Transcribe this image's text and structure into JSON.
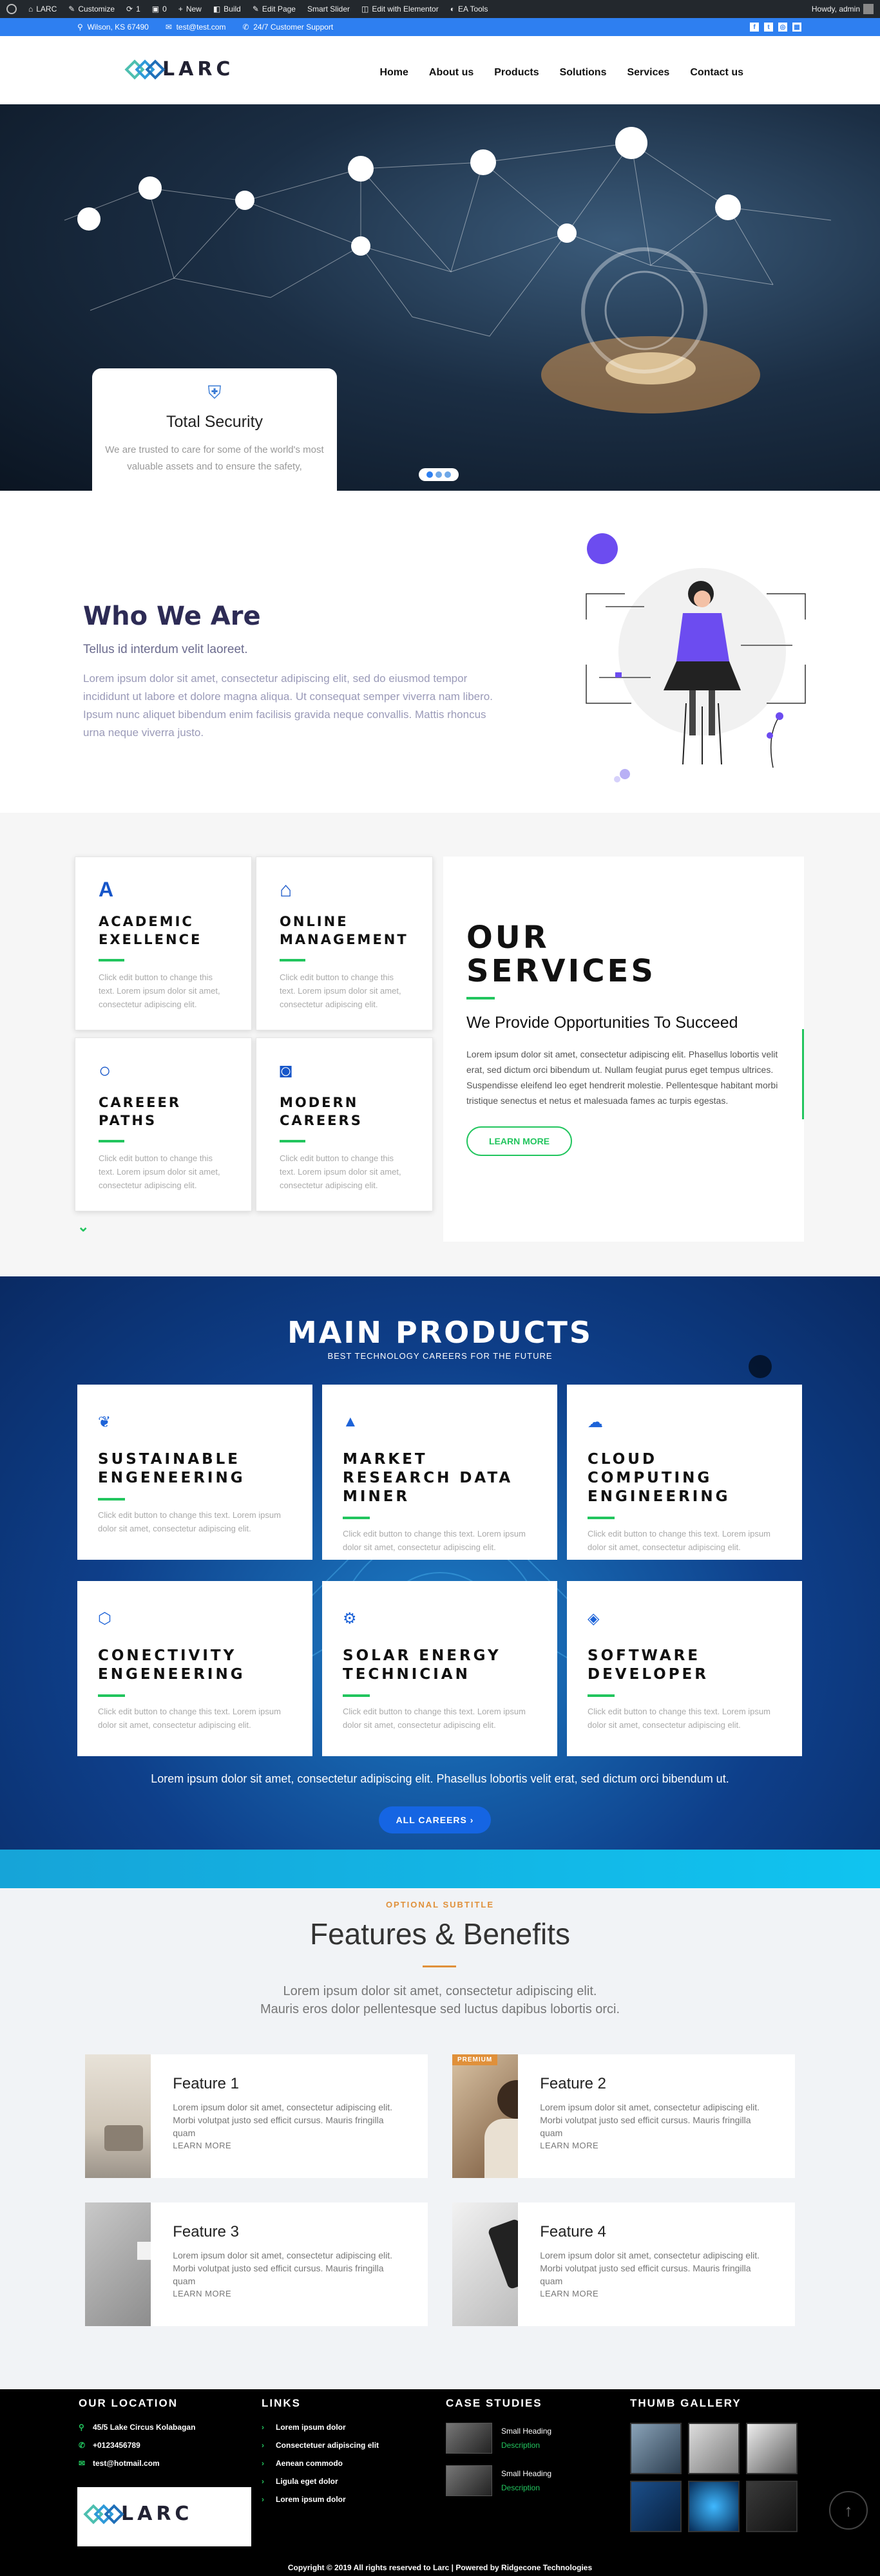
{
  "admin_bar": {
    "site": "LARC",
    "customize": "Customize",
    "updates": "1",
    "comments": "0",
    "new": "New",
    "build": "Build",
    "edit_page": "Edit Page",
    "smart_slider": "Smart Slider",
    "elementor": "Edit with Elementor",
    "ea_tools": "EA Tools",
    "howdy": "Howdy, admin"
  },
  "topbar": {
    "location": "Wilson, KS 67490",
    "email": "test@test.com",
    "phone": "24/7 Customer Support",
    "social": [
      "f",
      "t",
      "◎",
      "▦"
    ]
  },
  "brand": {
    "name": "LARC"
  },
  "nav": [
    "Home",
    "About us",
    "Products",
    "Solutions",
    "Services",
    "Contact us"
  ],
  "hero": {
    "card_title": "Total Security",
    "card_text": "We are trusted to care for some of the world's most valuable assets and to ensure the safety,"
  },
  "who": {
    "title": "Who We Are",
    "subtitle": "Tellus id interdum velit laoreet.",
    "body": "Lorem ipsum dolor sit amet, consectetur adipiscing elit, sed do eiusmod tempor incididunt ut labore et dolore magna aliqua. Ut consequat semper viverra nam libero. Ipsum nunc aliquet bibendum enim facilisis gravida neque convallis. Mattis rhoncus urna neque viverra justo."
  },
  "services": {
    "cards": [
      {
        "icon": "A",
        "title": "ACADEMIC EXELLENCE",
        "text": "Click edit button to change this text. Lorem ipsum dolor sit amet, consectetur adipiscing elit."
      },
      {
        "icon": "⌂",
        "title": "ONLINE MANAGEMENT",
        "text": "Click edit button to change this text. Lorem ipsum dolor sit amet, consectetur adipiscing elit."
      },
      {
        "icon": "○",
        "title": "CAREEER PATHS",
        "text": "Click edit button to change this text. Lorem ipsum dolor sit amet, consectetur adipiscing elit."
      },
      {
        "icon": "◙",
        "title": "MODERN CAREERS",
        "text": "Click edit button to change this text. Lorem ipsum dolor sit amet, consectetur adipiscing elit."
      }
    ],
    "heading": "OUR SERVICES",
    "subheading": "We Provide Opportunities To Succeed",
    "text": "Lorem ipsum dolor sit amet, consectetur adipiscing elit. Phasellus lobortis velit erat, sed dictum orci bibendum ut. Nullam feugiat purus eget tempus ultrices. Suspendisse eleifend leo eget hendrerit molestie. Pellentesque habitant morbi tristique senectus et netus et malesuada fames ac turpis egestas.",
    "button": "LEARN MORE"
  },
  "products": {
    "title": "MAIN PRODUCTS",
    "subtitle": "BEST TECHNOLOGY CAREERS FOR THE FUTURE",
    "cards": [
      {
        "icon": "❦",
        "title": "SUSTAINABLE ENGENEERING",
        "text": "Click edit button to change this text. Lorem ipsum dolor sit amet, consectetur adipiscing elit."
      },
      {
        "icon": "▲",
        "title": "MARKET RESEARCH DATA MINER",
        "text": "Click edit button to change this text. Lorem ipsum dolor sit amet, consectetur adipiscing elit."
      },
      {
        "icon": "☁",
        "title": "CLOUD COMPUTING ENGINEERING",
        "text": "Click edit button to change this text. Lorem ipsum dolor sit amet, consectetur adipiscing elit."
      },
      {
        "icon": "⬡",
        "title": "CONECTIVITY ENGENEERING",
        "text": "Click edit button to change this text. Lorem ipsum dolor sit amet, consectetur adipiscing elit."
      },
      {
        "icon": "⚙",
        "title": "SOLAR ENERGY TECHNICIAN",
        "text": "Click edit button to change this text. Lorem ipsum dolor sit amet, consectetur adipiscing elit."
      },
      {
        "icon": "◈",
        "title": "SOFTWARE DEVELOPER",
        "text": "Click edit button to change this text. Lorem ipsum dolor sit amet, consectetur adipiscing elit."
      }
    ],
    "lead": "Lorem ipsum dolor sit amet, consectetur adipiscing elit. Phasellus lobortis velit erat, sed dictum orci bibendum ut.",
    "button": "ALL CAREERS ›"
  },
  "features": {
    "optional": "OPTIONAL SUBTITLE",
    "title": "Features & Benefits",
    "intro1": "Lorem ipsum dolor sit amet, consectetur adipiscing elit.",
    "intro2": "Mauris eros dolor pellentesque sed luctus dapibus lobortis orci.",
    "items": [
      {
        "title": "Feature 1",
        "text": "Lorem ipsum dolor sit amet, consectetur adipiscing elit. Morbi volutpat justo sed efficit cursus. Mauris fringilla quam",
        "more": "LEARN MORE",
        "badge": ""
      },
      {
        "title": "Feature 2",
        "text": "Lorem ipsum dolor sit amet, consectetur adipiscing elit. Morbi volutpat justo sed efficit cursus. Mauris fringilla quam",
        "more": "LEARN MORE",
        "badge": "PREMIUM"
      },
      {
        "title": "Feature 3",
        "text": "Lorem ipsum dolor sit amet, consectetur adipiscing elit. Morbi volutpat justo sed efficit cursus. Mauris fringilla quam",
        "more": "LEARN MORE",
        "badge": ""
      },
      {
        "title": "Feature 4",
        "text": "Lorem ipsum dolor sit amet, consectetur adipiscing elit. Morbi volutpat justo sed efficit cursus. Mauris fringilla quam",
        "more": "LEARN MORE",
        "badge": ""
      }
    ]
  },
  "footer": {
    "location": {
      "title": "OUR LOCATION",
      "address": "45/5 Lake Circus Kolabagan",
      "phone": "+0123456789",
      "email": "test@hotmail.com"
    },
    "links": {
      "title": "LINKS",
      "items": [
        "Lorem ipsum dolor",
        "Consectetuer adipiscing elit",
        "Aenean commodo",
        "Ligula eget dolor",
        "Lorem ipsum dolor"
      ]
    },
    "case": {
      "title": "CASE STUDIES",
      "items": [
        {
          "heading": "Small Heading",
          "desc": "Description"
        },
        {
          "heading": "Small Heading",
          "desc": "Description"
        }
      ]
    },
    "gallery": {
      "title": "THUMB GALLERY"
    },
    "copyright": "Copyright © 2019 All rights reserved to Larc | Powered by Ridgecone Technologies"
  }
}
